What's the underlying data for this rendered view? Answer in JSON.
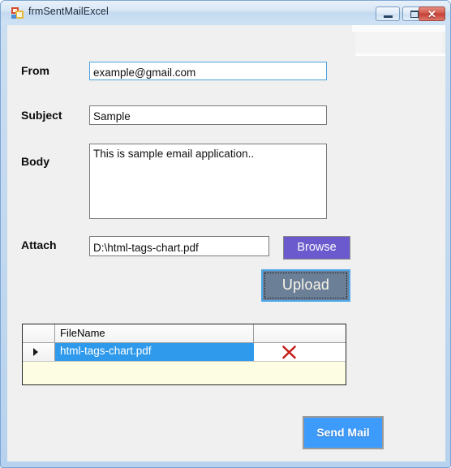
{
  "window": {
    "title": "frmSentMailExcel",
    "icon": "vb-form-icon",
    "controls": {
      "minimize_label": "—",
      "maximize_label": "□",
      "close_label": "✕"
    },
    "colors": {
      "frame": "#c3d9ef",
      "client": "#f0f0f0",
      "close_button": "#c33f34",
      "focus_border": "#4fa3dd"
    }
  },
  "form": {
    "fields": [
      {
        "label": "From",
        "value": "example@gmail.com",
        "placeholder": ""
      },
      {
        "label": "Subject",
        "value": "Sample",
        "placeholder": ""
      },
      {
        "label": "Body",
        "value": "This is sample email application..",
        "placeholder": ""
      },
      {
        "label": "Attach",
        "value": "D:\\html-tags-chart.pdf",
        "placeholder": ""
      }
    ],
    "buttons": {
      "browse": {
        "label": "Browse",
        "color": "#6a5acd"
      },
      "upload": {
        "label": "Upload",
        "color": "#6b7f96",
        "border_color": "#4da6e8",
        "focused": "true"
      },
      "send": {
        "label": "Send Mail",
        "color": "#3d9bfb"
      }
    }
  },
  "grid": {
    "columns": [
      "",
      "FileName",
      ""
    ],
    "rows": [
      {
        "selector": "▶",
        "filename": "html-tags-chart.pdf",
        "delete_icon": "red-x-icon",
        "selected": "true"
      }
    ],
    "selection_color": "#2f9aec",
    "newrow_color": "#fdfde3"
  }
}
